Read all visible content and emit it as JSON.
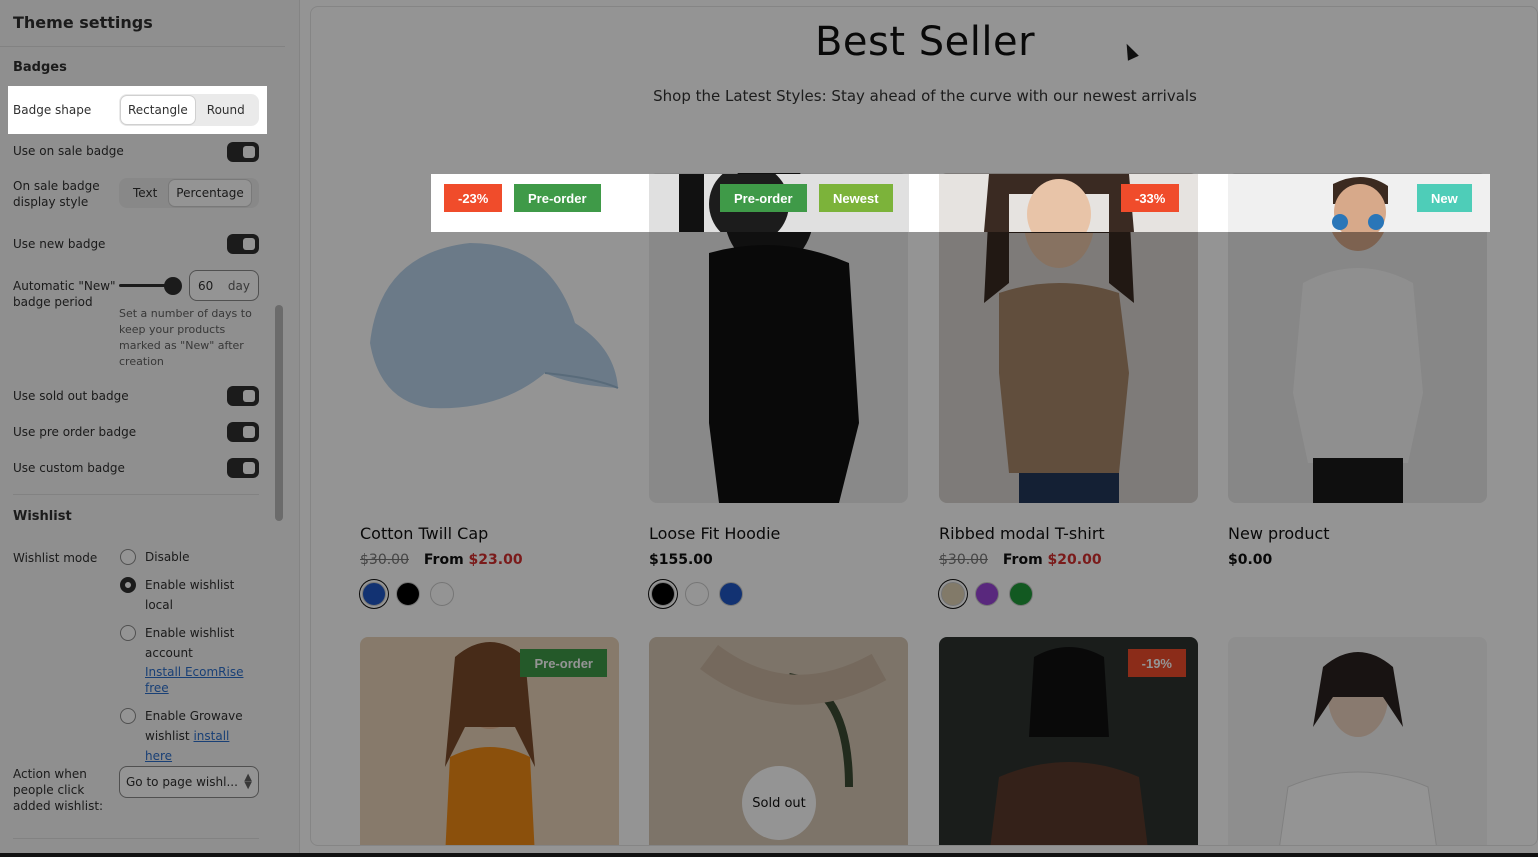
{
  "sidebar": {
    "title": "Theme settings",
    "badges_heading": "Badges",
    "badge_shape_label": "Badge shape",
    "badge_shape_options": [
      "Rectangle",
      "Round"
    ],
    "use_on_sale": "Use on sale badge",
    "on_sale_style_label": "On sale badge display style",
    "on_sale_style_options": [
      "Text",
      "Percentage"
    ],
    "use_new": "Use new badge",
    "auto_new_label": "Automatic \"New\" badge period",
    "auto_new_value": "60",
    "auto_new_unit": "day",
    "auto_new_help": "Set a number of days to keep your products marked as \"New\" after creation",
    "use_sold_out": "Use sold out badge",
    "use_pre_order": "Use pre order badge",
    "use_custom": "Use custom badge",
    "wishlist_heading": "Wishlist",
    "wishlist_mode_label": "Wishlist mode",
    "wishlist_opts": {
      "disable": "Disable",
      "local": "Enable wishlist local",
      "account": "Enable wishlist account",
      "ecomrise_link": "Install EcomRise free",
      "growave_text": "Enable Growave wishlist",
      "growave_link": "install here"
    },
    "action_label": "Action when people click added wishlist:",
    "action_value": "Go to page wishl..."
  },
  "preview": {
    "title": "Best Seller",
    "subtitle": "Shop the Latest Styles: Stay ahead of the curve with our newest arrivals",
    "products": [
      {
        "name": "Cotton Twill Cap",
        "old_price": "$30.00",
        "price_prefix": "From",
        "price": "$23.00",
        "badges": [
          "-23%",
          "Pre-order"
        ]
      },
      {
        "name": "Loose Fit Hoodie",
        "price": "$155.00",
        "badges": [
          "Pre-order",
          "Newest"
        ]
      },
      {
        "name": "Ribbed modal T-shirt",
        "old_price": "$30.00",
        "price_prefix": "From",
        "price": "$20.00",
        "badges": [
          "-33%"
        ]
      },
      {
        "name": "New product",
        "price": "$0.00",
        "badges": [
          "New"
        ]
      }
    ],
    "row2_badges": {
      "card1": "Pre-order",
      "card2": "Sold out",
      "card3": "-19%"
    }
  },
  "colors": {
    "sale_badge": "#f04c2b",
    "preorder_badge": "#3f9a48",
    "newest_badge": "#7cb33a",
    "new_badge": "#4ecdb8",
    "sale_price": "#d3302f"
  }
}
